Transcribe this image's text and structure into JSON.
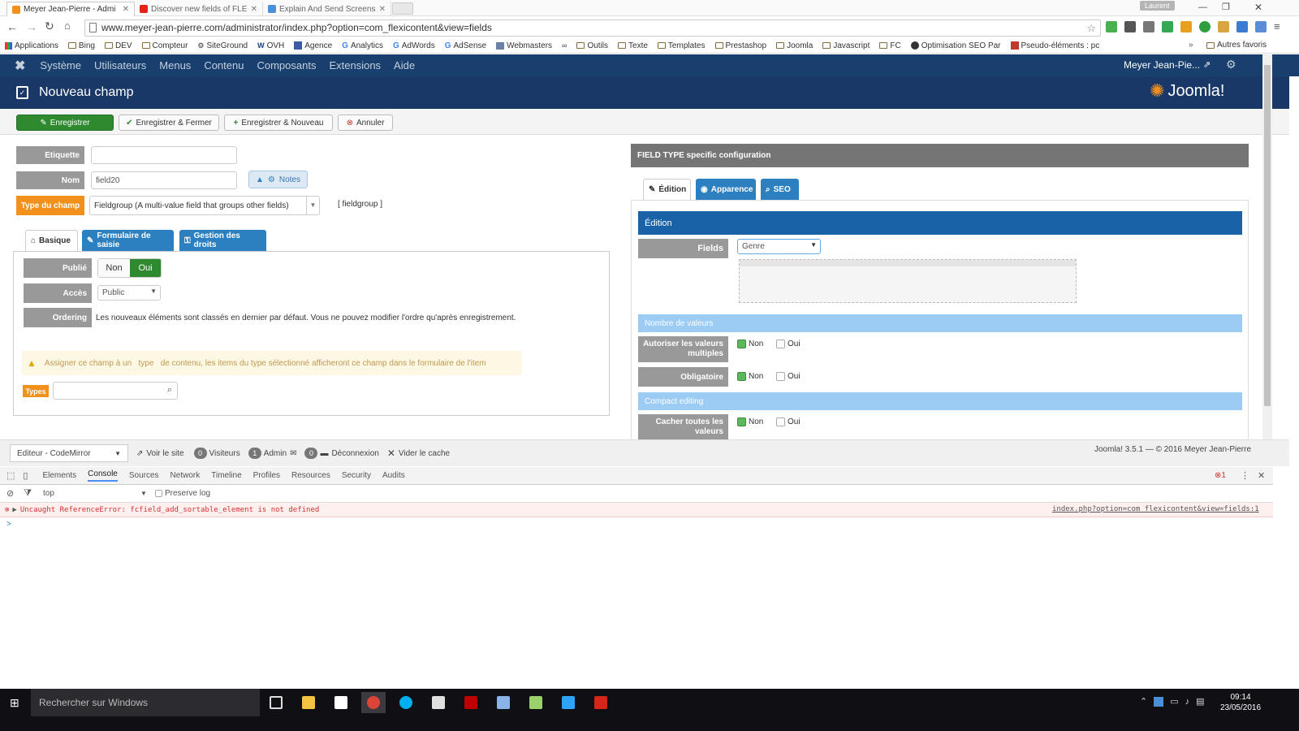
{
  "browser": {
    "tabs": [
      {
        "title": "Meyer Jean-Pierre - Admi",
        "color": "#f2901c",
        "active": true
      },
      {
        "title": "Discover new fields of FLE",
        "color": "#e62117",
        "active": false
      },
      {
        "title": "Explain And Send Screens",
        "color": "#4a90d9",
        "active": false
      }
    ],
    "profile": "Laurent",
    "url": "www.meyer-jean-pierre.com/administrator/index.php?option=com_flexicontent&view=fields",
    "bookmarks": [
      "Applications",
      "Bing",
      "DEV",
      "Compteur",
      "SiteGround",
      "OVH",
      "Agence",
      "Analytics",
      "AdWords",
      "AdSense",
      "Webmasters",
      "Outils",
      "Texte",
      "Templates",
      "Prestashop",
      "Joomla",
      "Javascript",
      "FC",
      "Optimisation SEO Par",
      "Pseudo-éléments : pc"
    ],
    "bookmarks_more": "»",
    "other_bookmarks": "Autres favoris"
  },
  "joomla": {
    "menu": [
      "Système",
      "Utilisateurs",
      "Menus",
      "Contenu",
      "Composants",
      "Extensions",
      "Aide"
    ],
    "user": "Meyer Jean-Pie...",
    "page_title": "Nouveau champ",
    "brand": "Joomla!",
    "toolbar": {
      "save": "Enregistrer",
      "save_close": "Enregistrer & Fermer",
      "save_new": "Enregistrer & Nouveau",
      "cancel": "Annuler"
    },
    "form": {
      "label_label": "Etiquette",
      "label_value": "",
      "name_label": "Nom",
      "name_value": "field20",
      "notes_button": "Notes",
      "type_label": "Type du champ",
      "type_value": "Fieldgroup (A multi-value field that groups other fields)",
      "type_code": "[ fieldgroup ]",
      "tabs": [
        "Basique",
        "Formulaire de saisie",
        "Gestion des droits"
      ],
      "published_label": "Publié",
      "published_no": "Non",
      "published_yes": "Oui",
      "access_label": "Accès",
      "access_value": "Public",
      "ordering_label": "Ordering",
      "ordering_text": "Les nouveaux éléments sont classés en dernier par défaut. Vous ne pouvez modifier l'ordre qu'après enregistrement.",
      "warning_text": "Assigner ce champ à un   type   de contenu, les items du type sélectionné afficheront ce champ dans le formulaire de l'item",
      "types_label": "Types",
      "types_value": ""
    },
    "config": {
      "header": "FIELD TYPE specific configuration",
      "tabs": [
        "Édition",
        "Apparence",
        "SEO"
      ],
      "section_edition": "Édition",
      "fields_label": "Fields",
      "fields_value": "Genre",
      "section_values": "Nombre de valeurs",
      "multiple_label": "Autoriser les valeurs multiples",
      "required_label": "Obligatoire",
      "no": "Non",
      "yes": "Oui",
      "section_compact": "Compact editing",
      "hide_all_label": "Cacher toutes les valeurs"
    },
    "status": {
      "editor": "Editeur - CodeMirror",
      "view_site": "Voir le site",
      "visitors_count": "0",
      "visitors": "Visiteurs",
      "admin_count": "1",
      "admin": "Admin",
      "logout_count": "0",
      "logout": "Déconnexion",
      "clear_cache": "Vider le cache",
      "version": "Joomla! 3.5.1 — © 2016 Meyer Jean-Pierre"
    }
  },
  "devtools": {
    "tabs": [
      "Elements",
      "Console",
      "Sources",
      "Network",
      "Timeline",
      "Profiles",
      "Resources",
      "Security",
      "Audits"
    ],
    "active_tab": "Console",
    "error_count": "1",
    "context": "top",
    "preserve_log": "Preserve log",
    "error": "Uncaught ReferenceError: fcfield_add_sortable_element is not defined",
    "error_source": "index.php?option=com_flexicontent&view=fields:1",
    "prompt": ">"
  },
  "taskbar": {
    "search_placeholder": "Rechercher sur Windows",
    "time": "09:14",
    "date": "23/05/2016",
    "apps": [
      {
        "name": "task-view",
        "color": "#dddddd"
      },
      {
        "name": "explorer",
        "color": "#f5c342"
      },
      {
        "name": "store",
        "color": "#ffffff"
      },
      {
        "name": "chrome",
        "color": "#db4437"
      },
      {
        "name": "skype",
        "color": "#00aff0"
      },
      {
        "name": "calculator",
        "color": "#e0e0e0"
      },
      {
        "name": "filezilla",
        "color": "#bf0000"
      },
      {
        "name": "notepad-pp",
        "color": "#8ab4e8"
      },
      {
        "name": "notepad",
        "color": "#9bd16a"
      },
      {
        "name": "photoshop",
        "color": "#2fa3f7"
      },
      {
        "name": "acrobat",
        "color": "#d6261a"
      }
    ]
  }
}
